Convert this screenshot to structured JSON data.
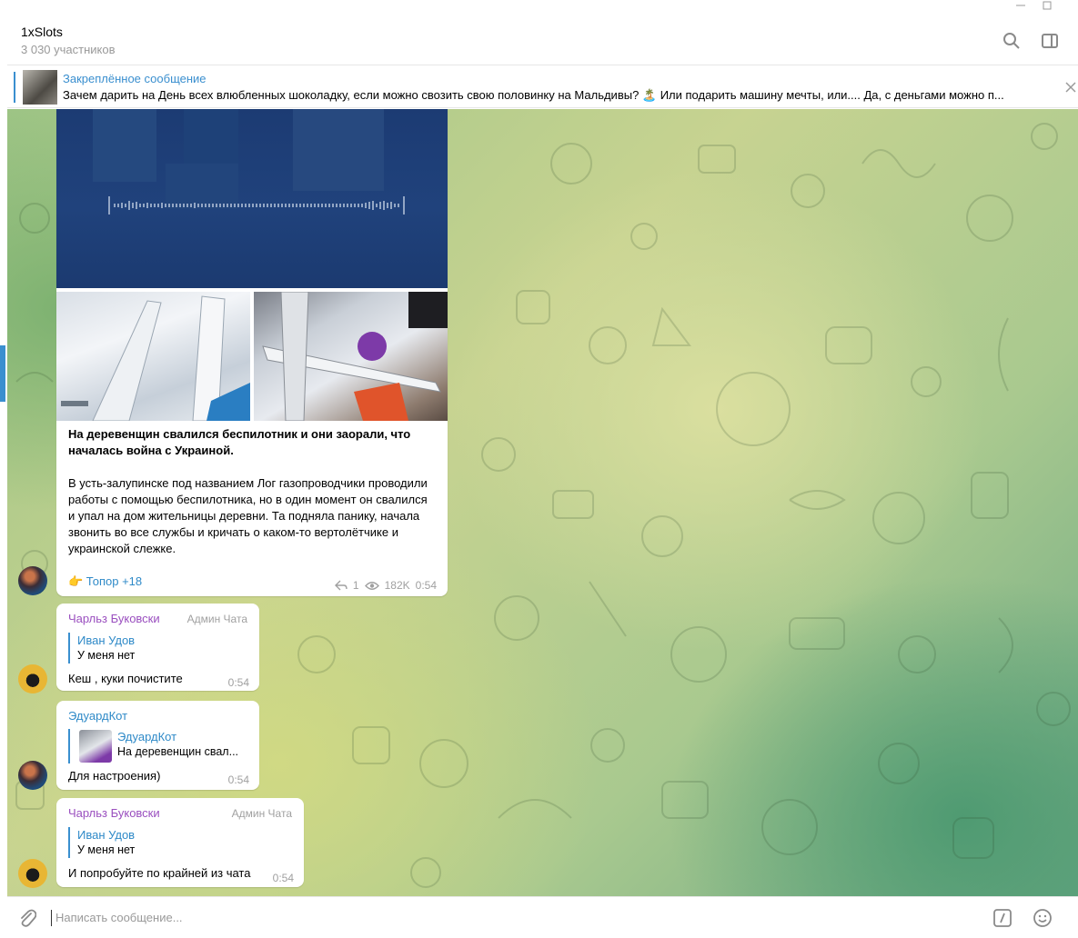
{
  "header": {
    "title": "1xSlots",
    "subtitle": "3 030 участников"
  },
  "pinned": {
    "title": "Закреплённое сообщение",
    "text": "Зачем дарить на День всех влюбленных шоколадку, если можно свозить свою половинку на Мальдивы? 🏝️  Или подарить машину мечты, или.... Да, с деньгами можно п..."
  },
  "post": {
    "title": "На деревенщин свалился беспилотник и они заорали, что началась война с Украиной.",
    "body": "В усть-залупинске под названием Лог газопроводчики проводили работы с помощью беспилотника, но в один момент он свалился и упал на дом жительницы деревни. Та подняла панику, начала звонить во все службы и кричать о каком-то вертолётчике и украинской слежке.",
    "reaction": "👉 Топор +18",
    "replies": "1",
    "views": "182K",
    "time": "0:54"
  },
  "messages": [
    {
      "sender": "Чарльз Буковски",
      "role": "Админ Чата",
      "reply_name": "Иван Удов",
      "reply_text": "У меня нет",
      "text": "Кеш , куки почистите",
      "time": "0:54"
    },
    {
      "sender": "ЭдуардКот",
      "reply_name": "ЭдуардКот",
      "reply_text": "На деревенщин свал...",
      "text": "Для настроения)",
      "time": "0:54"
    },
    {
      "sender": "Чарльз Буковски",
      "role": "Админ Чата",
      "reply_name": "Иван Удов",
      "reply_text": "У меня нет",
      "text": "И попробуйте по крайней из чата",
      "time": "0:54"
    }
  ],
  "compose": {
    "placeholder": "Написать сообщение..."
  },
  "icons": {
    "search": "search-icon",
    "sidebar": "sidebar-toggle-icon",
    "attach": "paperclip-icon",
    "commands": "slash-command-icon",
    "emoji": "emoji-icon"
  },
  "colors": {
    "accent": "#3a8fcf",
    "admin_name": "#9a4fbf"
  }
}
